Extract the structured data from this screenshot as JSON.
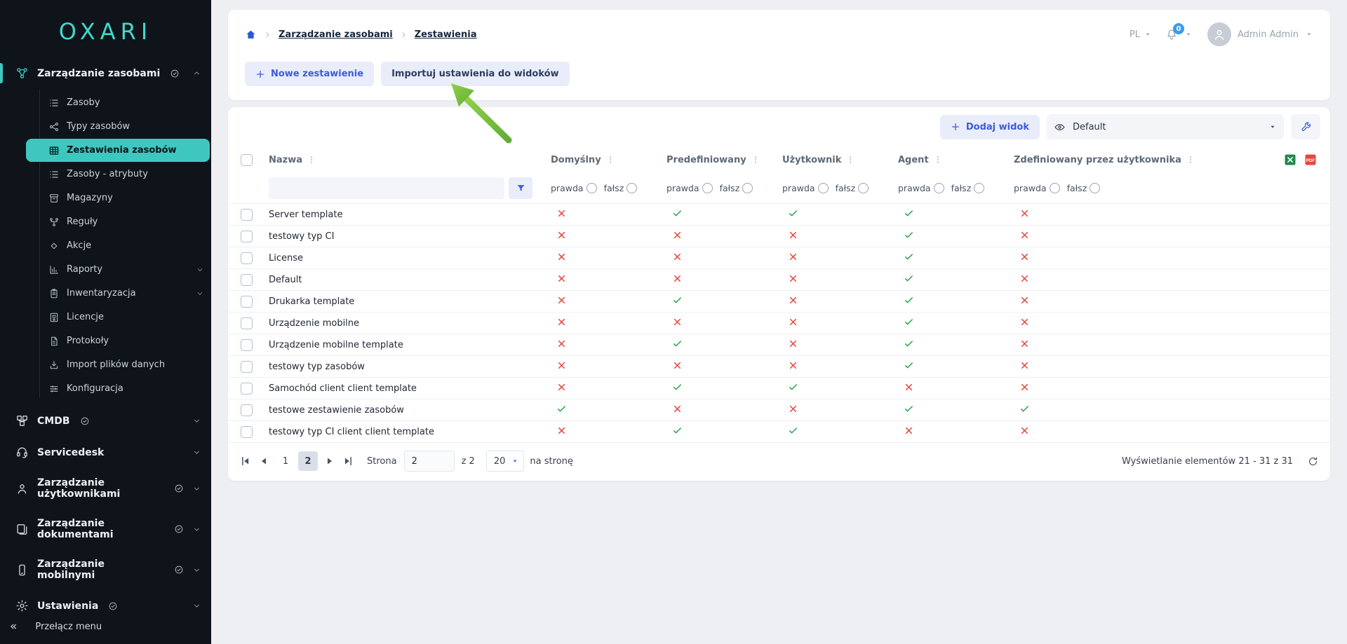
{
  "colors": {
    "accent_teal": "#3ec7bf",
    "accent_blue": "#3d5bd9",
    "check_green": "#2aa14c",
    "cross_red": "#e2483d",
    "arrow_green": "#76bf3f"
  },
  "sidebar": {
    "logo": "OXARI",
    "sections": [
      {
        "label": "Zarządzanie zasobami",
        "icon": "nodes",
        "active": true,
        "expanded": true,
        "badge": true,
        "chevron": true,
        "children": [
          {
            "label": "Zasoby",
            "icon": "list"
          },
          {
            "label": "Typy zasobów",
            "icon": "share"
          },
          {
            "label": "Zestawienia zasobów",
            "icon": "grid",
            "selected": true
          },
          {
            "label": "Zasoby - atrybuty",
            "icon": "list"
          },
          {
            "label": "Magazyny",
            "icon": "archive"
          },
          {
            "label": "Reguły",
            "icon": "flow"
          },
          {
            "label": "Akcje",
            "icon": "diamond"
          },
          {
            "label": "Raporty",
            "icon": "chart",
            "chevron": true
          },
          {
            "label": "Inwentaryzacja",
            "icon": "clipboard",
            "chevron": true
          },
          {
            "label": "Licencje",
            "icon": "license"
          },
          {
            "label": "Protokoły",
            "icon": "doc"
          },
          {
            "label": "Import plików danych",
            "icon": "import"
          },
          {
            "label": "Konfiguracja",
            "icon": "sliders"
          }
        ]
      },
      {
        "label": "CMDB",
        "icon": "cmdb",
        "badge": true,
        "chevron": true
      },
      {
        "label": "Servicedesk",
        "icon": "headset",
        "chevron": true
      },
      {
        "label": "Zarządzanie użytkownikami",
        "icon": "users",
        "badge": true,
        "chevron": true
      },
      {
        "label": "Zarządzanie dokumentami",
        "icon": "documents",
        "badge": true,
        "chevron": true
      },
      {
        "label": "Zarządzanie mobilnymi",
        "icon": "mobile",
        "badge": true,
        "chevron": true
      },
      {
        "label": "Ustawienia",
        "icon": "settings",
        "badge": true,
        "chevron": true
      }
    ],
    "footer": {
      "label": "Przełącz menu"
    }
  },
  "topbar": {
    "breadcrumb": {
      "section": "Zarządzanie zasobami",
      "page": "Zestawienia"
    },
    "language": "PL",
    "notification_count": "0",
    "user": "Admin Admin"
  },
  "page": {
    "new_button": "Nowe zestawienie",
    "import_button": "Importuj ustawienia do widoków"
  },
  "toolbar": {
    "add_view": "Dodaj widok",
    "view_select": "Default"
  },
  "table": {
    "name_column": "Nazwa",
    "bool_columns": [
      "Domyślny",
      "Predefiniowany",
      "Użytkownik",
      "Agent",
      "Zdefiniowany przez użytkownika"
    ],
    "filter_true": "prawda",
    "filter_false": "fałsz",
    "rows": [
      {
        "name": "Server template",
        "values": [
          false,
          true,
          true,
          true,
          false
        ]
      },
      {
        "name": "testowy typ CI",
        "values": [
          false,
          false,
          false,
          true,
          false
        ]
      },
      {
        "name": "License",
        "values": [
          false,
          false,
          false,
          true,
          false
        ]
      },
      {
        "name": "Default",
        "values": [
          false,
          false,
          false,
          true,
          false
        ]
      },
      {
        "name": "Drukarka template",
        "values": [
          false,
          true,
          false,
          true,
          false
        ]
      },
      {
        "name": "Urządzenie mobilne",
        "values": [
          false,
          false,
          false,
          true,
          false
        ]
      },
      {
        "name": "Urządzenie mobilne template",
        "values": [
          false,
          true,
          false,
          true,
          false
        ]
      },
      {
        "name": "testowy typ zasobów",
        "values": [
          false,
          false,
          false,
          true,
          false
        ]
      },
      {
        "name": "Samochód client client template",
        "values": [
          false,
          true,
          true,
          false,
          false
        ]
      },
      {
        "name": "testowe zestawienie zasobów",
        "values": [
          true,
          false,
          false,
          true,
          true
        ]
      },
      {
        "name": "testowy typ CI client client template",
        "values": [
          false,
          true,
          true,
          false,
          false
        ]
      }
    ]
  },
  "pagination": {
    "pages": [
      "1",
      "2"
    ],
    "current": "2",
    "page_label": "Strona",
    "page_input": "2",
    "of_label": "z 2",
    "page_size": "20",
    "per_page_label": "na stronę",
    "summary": "Wyświetlanie elementów 21 - 31 z 31"
  }
}
